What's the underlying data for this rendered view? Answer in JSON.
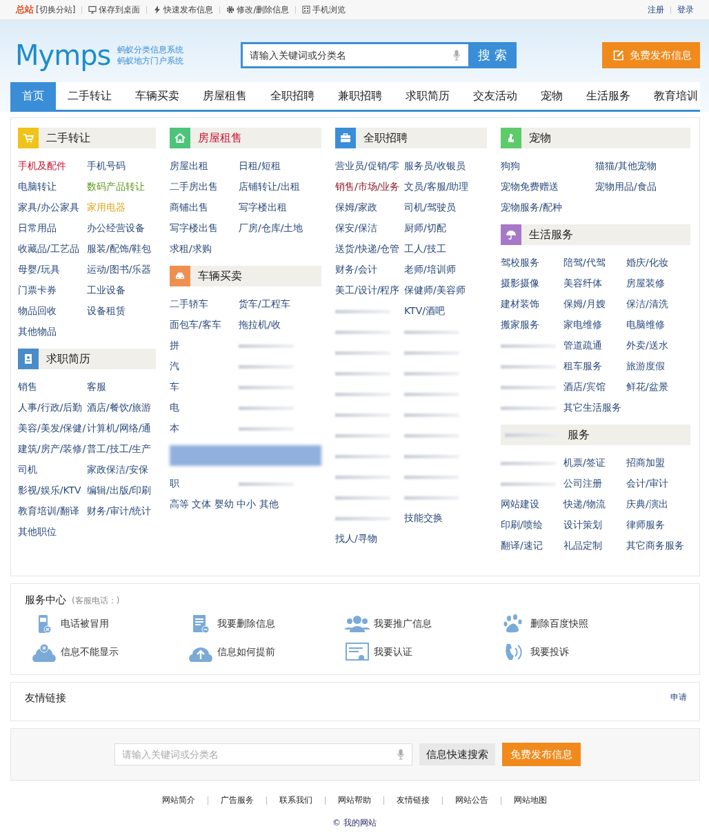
{
  "topbar": {
    "brand": "总站",
    "switch": "[切换分站]",
    "links": [
      {
        "text": "保存到桌面"
      },
      {
        "text": "快速发布信息"
      },
      {
        "text": "修改/删除信息"
      },
      {
        "text": "手机浏览"
      }
    ],
    "account": [
      "注册",
      "登录"
    ]
  },
  "header": {
    "logo": "Mymps",
    "tagline": [
      "蚂蚁分类信息系统",
      "蚂蚁地方门户系统"
    ],
    "search": {
      "placeholder": "请输入关键词或分类名",
      "button": "搜 索"
    },
    "post_button": "免费发布信息"
  },
  "nav": [
    {
      "label": "首页",
      "selected": true
    },
    {
      "label": "二手转让",
      "selected": false
    },
    {
      "label": "车辆买卖",
      "selected": false
    },
    {
      "label": "房屋租售",
      "selected": false
    },
    {
      "label": "全职招聘",
      "selected": false
    },
    {
      "label": "兼职招聘",
      "selected": false
    },
    {
      "label": "求职简历",
      "selected": false
    },
    {
      "label": "交友活动",
      "selected": false
    },
    {
      "label": "宠物",
      "selected": false
    },
    {
      "label": "生活服务",
      "selected": false
    },
    {
      "label": "教育培训",
      "selected": false
    }
  ],
  "columns": [
    {
      "sections": [
        {
          "title": "二手转让",
          "items": [
            {
              "text": "手机及配件",
              "color": "#c8102e"
            },
            {
              "text": "手机号码"
            },
            {
              "text": "电脑转让"
            },
            {
              "text": "数码产品转让",
              "color": "#5a9a1a"
            },
            {
              "text": "家具/办公家具"
            },
            {
              "text": "家用电器",
              "color": "#e0a820"
            },
            {
              "text": "日常用品"
            },
            {
              "text": "办公经营设备"
            },
            {
              "text": "收藏品/工艺品"
            },
            {
              "text": "服装/配饰/鞋包"
            },
            {
              "text": "母婴/玩具"
            },
            {
              "text": "运动/图书/乐器"
            },
            {
              "text": "门票卡券"
            },
            {
              "text": "工业设备"
            },
            {
              "text": "物品回收"
            },
            {
              "text": "设备租赁"
            },
            {
              "text": "其他物品"
            }
          ]
        },
        {
          "title": "求职简历",
          "items": [
            {
              "text": "销售"
            },
            {
              "text": "客服"
            },
            {
              "text": "人事/行政/后勤"
            },
            {
              "text": "酒店/餐饮/旅游"
            },
            {
              "text": "美容/美发/保健/"
            },
            {
              "text": "计算机/网络/通"
            },
            {
              "text": "建筑/房产/装修/"
            },
            {
              "text": "普工/技工/生产"
            },
            {
              "text": "司机"
            },
            {
              "text": "家政保洁/安保"
            },
            {
              "text": "影视/娱乐/KTV"
            },
            {
              "text": "编辑/出版/印刷"
            },
            {
              "text": "教育培训/翻译"
            },
            {
              "text": "财务/审计/统计"
            },
            {
              "text": "其他职位"
            }
          ]
        }
      ]
    },
    {
      "sections": [
        {
          "title": "房屋租售",
          "items": [
            {
              "text": "房屋出租"
            },
            {
              "text": "日租/短租"
            },
            {
              "text": "二手房出售"
            },
            {
              "text": "店铺转让/出租"
            },
            {
              "text": "商铺出售"
            },
            {
              "text": "写字楼出租"
            },
            {
              "text": "写字楼出售"
            },
            {
              "text": "厂房/仓库/土地"
            },
            {
              "text": "求租/求购"
            }
          ]
        },
        {
          "title": "车辆买卖",
          "items": [
            {
              "text": "二手轿车"
            },
            {
              "text": "货车/工程车"
            },
            {
              "text": "面包车/客车"
            },
            {
              "text": "拖拉机/收"
            },
            {
              "text": "拼"
            },
            {
              "obscured": true
            },
            {
              "text": "汽"
            },
            {
              "obscured": true
            },
            {
              "text": "车"
            },
            {
              "obscured": true
            },
            {
              "text": "电"
            },
            {
              "obscured": true
            },
            {
              "text": "本"
            },
            {
              "obscured": true
            }
          ]
        },
        {
          "obscured": true,
          "items": [
            {
              "text": "职"
            },
            {
              "obscured": true
            }
          ],
          "note": "高等 文体 婴幼 中小 其他"
        }
      ]
    },
    {
      "sections": [
        {
          "title": "全职招聘",
          "items": [
            {
              "text": "营业员/促销/零"
            },
            {
              "text": "服务员/收银员"
            },
            {
              "text": "销售/市场/业务",
              "color": "#8a1a2a"
            },
            {
              "text": "文员/客服/助理"
            },
            {
              "text": "保姆/家政"
            },
            {
              "text": "司机/驾驶员"
            },
            {
              "text": "保安/保洁"
            },
            {
              "text": "厨师/切配"
            },
            {
              "text": "送货/快递/仓管"
            },
            {
              "text": "工人/技工"
            },
            {
              "text": "财务/会计"
            },
            {
              "text": "老师/培训师"
            },
            {
              "text": "美工/设计/程序"
            },
            {
              "text": "保健师/美容师"
            },
            {
              "obscured": true
            },
            {
              "text": "KTV/酒吧"
            },
            {
              "obscured": true
            },
            {
              "obscured": true
            },
            {
              "obscured": true
            },
            {
              "obscured": true
            },
            {
              "obscured": true
            },
            {
              "obscured": true
            },
            {
              "obscured": true
            },
            {
              "obscured": true
            },
            {
              "obscured": true
            },
            {
              "obscured": true
            },
            {
              "obscured": true
            },
            {
              "obscured": true
            },
            {
              "obscured": true
            },
            {
              "obscured": true
            },
            {
              "obscured": true
            },
            {
              "obscured": true
            },
            {
              "obscured": true
            },
            {
              "obscured": true
            },
            {
              "obscured": true
            },
            {
              "text": "技能交换"
            },
            {
              "text": "找人/寻物"
            }
          ]
        }
      ]
    },
    {
      "sections": [
        {
          "title": "宠物",
          "items": [
            {
              "text": "狗狗"
            },
            {
              "text": "猫猫/其他宠物"
            },
            {
              "text": "宠物免费赠送"
            },
            {
              "text": "宠物用品/食品"
            },
            {
              "text": "宠物服务/配种"
            }
          ]
        },
        {
          "title": "生活服务",
          "items": [
            {
              "text": "驾校服务"
            },
            {
              "text": "陪驾/代驾"
            },
            {
              "text": "婚庆/化妆"
            },
            {
              "text": "摄影摄像"
            },
            {
              "text": "美容纤体"
            },
            {
              "text": "房屋装修"
            },
            {
              "text": "建材装饰"
            },
            {
              "text": "保姆/月嫂"
            },
            {
              "text": "保洁/清洗"
            },
            {
              "text": "搬家服务"
            },
            {
              "text": "家电维修"
            },
            {
              "text": "电脑维修"
            },
            {
              "obscured": true
            },
            {
              "text": "管道疏通"
            },
            {
              "text": "外卖/送水"
            },
            {
              "obscured": true
            },
            {
              "text": "租车服务"
            },
            {
              "text": "旅游度假"
            },
            {
              "obscured": true
            },
            {
              "text": "酒店/宾馆"
            },
            {
              "text": "鲜花/盆景"
            },
            {
              "obscured": true
            },
            {
              "text": "其它生活服务"
            }
          ]
        },
        {
          "title": "服务",
          "obscured": true,
          "items": [
            {
              "obscured": true
            },
            {
              "text": "机票/签证"
            },
            {
              "text": "招商加盟"
            },
            {
              "obscured": true
            },
            {
              "text": "公司注册"
            },
            {
              "text": "会计/审计"
            },
            {
              "text": "网站建设"
            },
            {
              "text": "快递/物流"
            },
            {
              "text": "庆典/演出"
            },
            {
              "text": "印刷/喷绘"
            },
            {
              "text": "设计策划"
            },
            {
              "text": "律师服务"
            },
            {
              "text": "翻译/速记"
            },
            {
              "text": "礼品定制"
            },
            {
              "text": "其它商务服务"
            }
          ]
        }
      ]
    }
  ],
  "service_center": {
    "title": "服务中心",
    "phone_label": "(客服电话：)",
    "items": [
      "电话被冒用",
      "我要删除信息",
      "我要推广信息",
      "删除百度快照",
      "信息不能显示",
      "信息如何提前",
      "我要认证",
      "我要投诉"
    ]
  },
  "friend_links": {
    "title": "友情链接",
    "apply": "申请"
  },
  "bottom_search": {
    "placeholder": "请输入关键词或分类名",
    "search_button": "信息快速搜索",
    "post_button": "免费发布信息"
  },
  "footer": {
    "links": [
      "网站简介",
      "广告服务",
      "联系我们",
      "网站帮助",
      "友情链接",
      "网站公告",
      "网站地图"
    ],
    "copyright": "© 我的网站"
  }
}
